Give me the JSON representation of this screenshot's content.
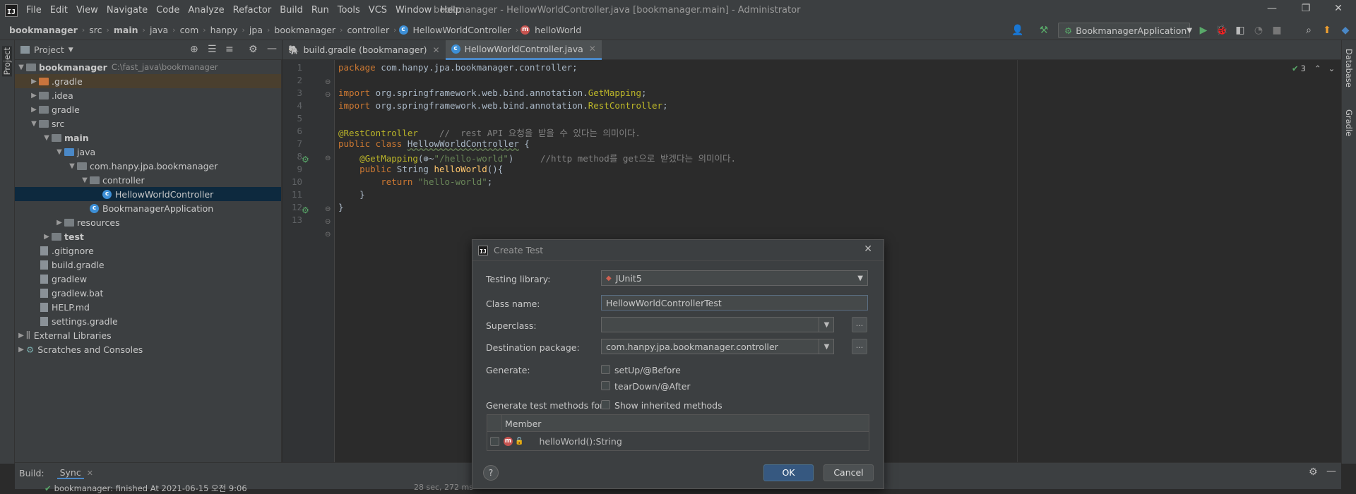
{
  "menu": {
    "items": [
      "File",
      "Edit",
      "View",
      "Navigate",
      "Code",
      "Analyze",
      "Refactor",
      "Build",
      "Run",
      "Tools",
      "VCS",
      "Window",
      "Help"
    ],
    "window_title": "bookmanager - HellowWorldController.java [bookmanager.main] - Administrator"
  },
  "breadcrumb": [
    "bookmanager",
    "src",
    "main",
    "java",
    "com",
    "hanpy",
    "jpa",
    "bookmanager",
    "controller",
    "HellowWorldController",
    "helloWorld"
  ],
  "run_config": "BookmanagerApplication",
  "project_panel": {
    "title": "Project",
    "tree": [
      {
        "label": "bookmanager",
        "sub": "C:\\fast_java\\bookmanager",
        "level": 0,
        "arrow": "▼",
        "bold": true
      },
      {
        "label": ".gradle",
        "level": 1,
        "arrow": "▶",
        "icon": "orange"
      },
      {
        "label": ".idea",
        "level": 1,
        "arrow": "▶",
        "icon": "gray"
      },
      {
        "label": "gradle",
        "level": 1,
        "arrow": "▶",
        "icon": "gray"
      },
      {
        "label": "src",
        "level": 1,
        "arrow": "▼",
        "icon": "gray"
      },
      {
        "label": "main",
        "level": 2,
        "arrow": "▼",
        "icon": "gray",
        "bold": true
      },
      {
        "label": "java",
        "level": 3,
        "arrow": "▼",
        "icon": "blue"
      },
      {
        "label": "com.hanpy.jpa.bookmanager",
        "level": 4,
        "arrow": "▼",
        "icon": "gray"
      },
      {
        "label": "controller",
        "level": 5,
        "arrow": "▼",
        "icon": "gray"
      },
      {
        "label": "HellowWorldController",
        "level": 6,
        "arrow": "",
        "icon": "class",
        "selected": true
      },
      {
        "label": "BookmanagerApplication",
        "level": 5,
        "arrow": "",
        "icon": "class"
      },
      {
        "label": "resources",
        "level": 3,
        "arrow": "▶",
        "icon": "gray"
      },
      {
        "label": "test",
        "level": 2,
        "arrow": "▶",
        "icon": "gray",
        "bold": true
      },
      {
        "label": ".gitignore",
        "level": 1,
        "arrow": "",
        "icon": "file"
      },
      {
        "label": "build.gradle",
        "level": 1,
        "arrow": "",
        "icon": "file"
      },
      {
        "label": "gradlew",
        "level": 1,
        "arrow": "",
        "icon": "file"
      },
      {
        "label": "gradlew.bat",
        "level": 1,
        "arrow": "",
        "icon": "file"
      },
      {
        "label": "HELP.md",
        "level": 1,
        "arrow": "",
        "icon": "file"
      },
      {
        "label": "settings.gradle",
        "level": 1,
        "arrow": "",
        "icon": "file"
      },
      {
        "label": "External Libraries",
        "level": 0,
        "arrow": "▶",
        "icon": "lib"
      },
      {
        "label": "Scratches and Consoles",
        "level": 0,
        "arrow": "▶",
        "icon": "scratch"
      }
    ]
  },
  "tabs": [
    {
      "label": "build.gradle (bookmanager)",
      "active": false
    },
    {
      "label": "HellowWorldController.java",
      "active": true
    }
  ],
  "editor": {
    "line_numbers": [
      "1",
      "2",
      "3",
      "4",
      "5",
      "6",
      "7",
      "8",
      "9",
      "10",
      "11",
      "12",
      "13"
    ],
    "inspection_count": "3"
  },
  "dialog": {
    "title": "Create Test",
    "testing_library_label": "Testing library:",
    "testing_library_value": "JUnit5",
    "class_name_label": "Class name:",
    "class_name_value": "HellowWorldControllerTest",
    "superclass_label": "Superclass:",
    "superclass_value": "",
    "dest_pkg_label": "Destination package:",
    "dest_pkg_value": "com.hanpy.jpa.bookmanager.controller",
    "generate_label": "Generate:",
    "setup_label": "setUp/@Before",
    "teardown_label": "tearDown/@After",
    "gen_methods_label": "Generate test methods for:",
    "show_inherited_label": "Show inherited methods",
    "member_header": "Member",
    "member_item": "helloWorld():String",
    "help": "?",
    "ok": "OK",
    "cancel": "Cancel"
  },
  "bottom": {
    "build_label": "Build:",
    "sync_tab": "Sync",
    "status_text": "bookmanager: finished At 2021-06-15 오전 9:06",
    "status_time": "28 sec, 272 ms"
  },
  "side_tools": {
    "left": "Project",
    "right_top": "Database",
    "right_bottom": "Gradle"
  }
}
